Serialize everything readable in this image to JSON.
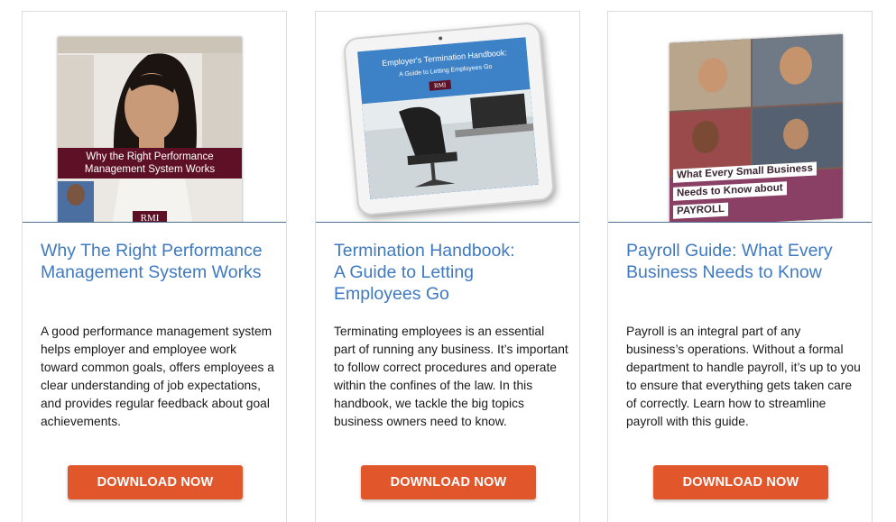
{
  "cards": [
    {
      "title": "Why The Right Performance Management System Works",
      "description": "A good performance management system helps employer and employee work toward common goals, offers employees a clear understanding of job expectations, and provides regular feedback about goal achievements.",
      "button_label": "DOWNLOAD NOW",
      "cover": {
        "heading_line1": "Why the Right Performance",
        "heading_line2": "Management System Works",
        "logo": "RMI"
      }
    },
    {
      "title_line1": "Termination Handbook:",
      "title_line2": "A Guide to Letting",
      "title_line3": "Employees Go",
      "description": "Terminating employees is an essential part of running any business. It’s important to follow correct procedures and operate within the confines of the law. In this handbook, we tackle the big topics business owners need to know.",
      "button_label": "DOWNLOAD NOW",
      "cover": {
        "heading": "Employer's Termination Handbook:",
        "subheading": "A Guide to Letting Employees Go",
        "logo": "RMI"
      }
    },
    {
      "title": "Payroll Guide: What Every Business Needs to Know",
      "description": "Payroll is an integral part of any business’s operations. Without a formal department to handle payroll, it’s up to you to ensure that everything gets taken care of correctly. Learn how to streamline payroll with this guide.",
      "button_label": "DOWNLOAD NOW",
      "cover": {
        "line1": "What Every Small Business",
        "line2": "Needs to Know about",
        "line3": "PAYROLL"
      }
    }
  ],
  "colors": {
    "title": "#3f7ac0",
    "button": "#e2562b",
    "cover_band": "#5e1126"
  }
}
